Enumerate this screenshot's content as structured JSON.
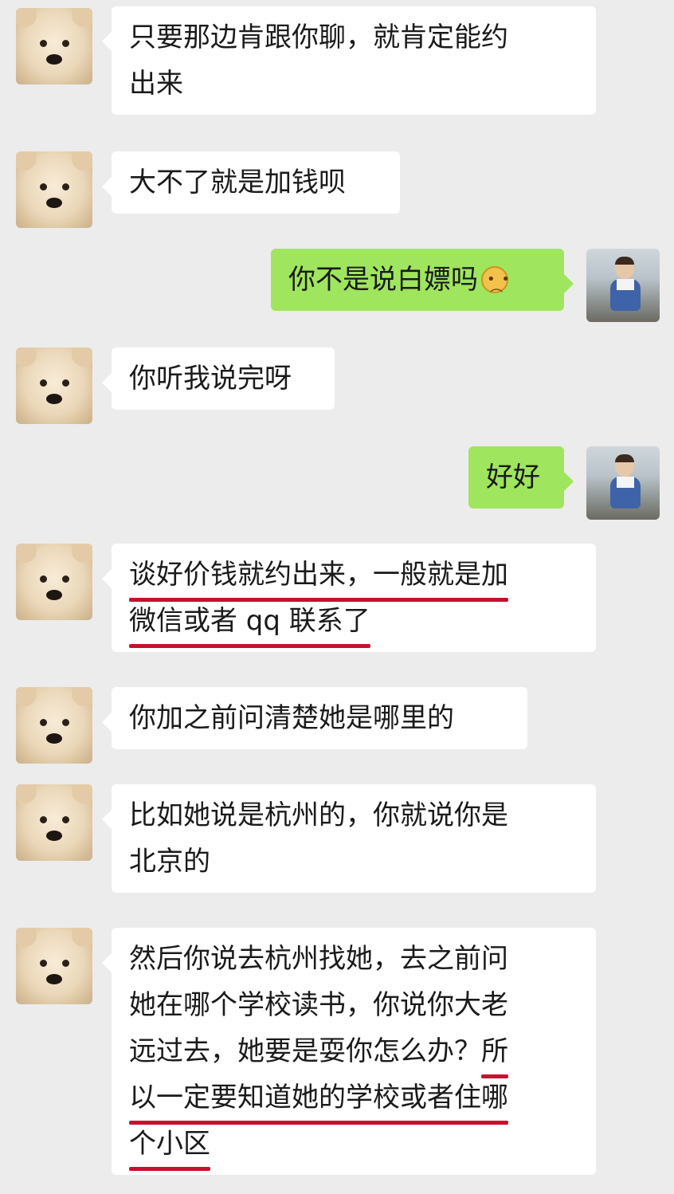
{
  "messages": [
    {
      "side": "left",
      "lines": [
        {
          "segments": [
            {
              "text": "只要那边肯跟你聊，就肯定能约",
              "u": false
            }
          ]
        },
        {
          "segments": [
            {
              "text": "出来",
              "u": false
            }
          ]
        }
      ]
    },
    {
      "side": "left",
      "lines": [
        {
          "segments": [
            {
              "text": "大不了就是加钱呗",
              "u": false
            }
          ]
        }
      ]
    },
    {
      "side": "right",
      "lines": [
        {
          "segments": [
            {
              "text": "你不是说白嫖吗",
              "u": false
            }
          ]
        }
      ],
      "emoji": "sad-face-emoji"
    },
    {
      "side": "left",
      "lines": [
        {
          "segments": [
            {
              "text": "你听我说完呀",
              "u": false
            }
          ]
        }
      ]
    },
    {
      "side": "right",
      "lines": [
        {
          "segments": [
            {
              "text": "好好",
              "u": false
            }
          ]
        }
      ]
    },
    {
      "side": "left",
      "lines": [
        {
          "segments": [
            {
              "text": "谈好价钱就约出来，一般就是加",
              "u": true
            }
          ]
        },
        {
          "segments": [
            {
              "text": "微信或者 qq 联系了",
              "u": true
            }
          ]
        }
      ]
    },
    {
      "side": "left",
      "lines": [
        {
          "segments": [
            {
              "text": "你加之前问清楚她是哪里的",
              "u": false
            }
          ]
        }
      ]
    },
    {
      "side": "left",
      "lines": [
        {
          "segments": [
            {
              "text": "比如她说是杭州的，你就说你是",
              "u": false
            }
          ]
        },
        {
          "segments": [
            {
              "text": "北京的",
              "u": false
            }
          ]
        }
      ]
    },
    {
      "side": "left",
      "lines": [
        {
          "segments": [
            {
              "text": "然后你说去杭州找她，去之前问",
              "u": false
            }
          ]
        },
        {
          "segments": [
            {
              "text": "她在哪个学校读书，你说你大老",
              "u": false
            }
          ]
        },
        {
          "segments": [
            {
              "text": "远过去，她要是耍你怎么办？",
              "u": false
            },
            {
              "text": "所",
              "u": true
            }
          ]
        },
        {
          "segments": [
            {
              "text": "以一定要知道她的学校或者住哪",
              "u": true
            }
          ]
        },
        {
          "segments": [
            {
              "text": "个小区",
              "u": true
            }
          ]
        }
      ]
    }
  ],
  "avatars": {
    "left": "dog-avatar",
    "right": "baby-avatar"
  },
  "colors": {
    "background": "#ececec",
    "incoming_bubble": "#ffffff",
    "outgoing_bubble": "#9fe55e",
    "underline": "#c8102e"
  }
}
